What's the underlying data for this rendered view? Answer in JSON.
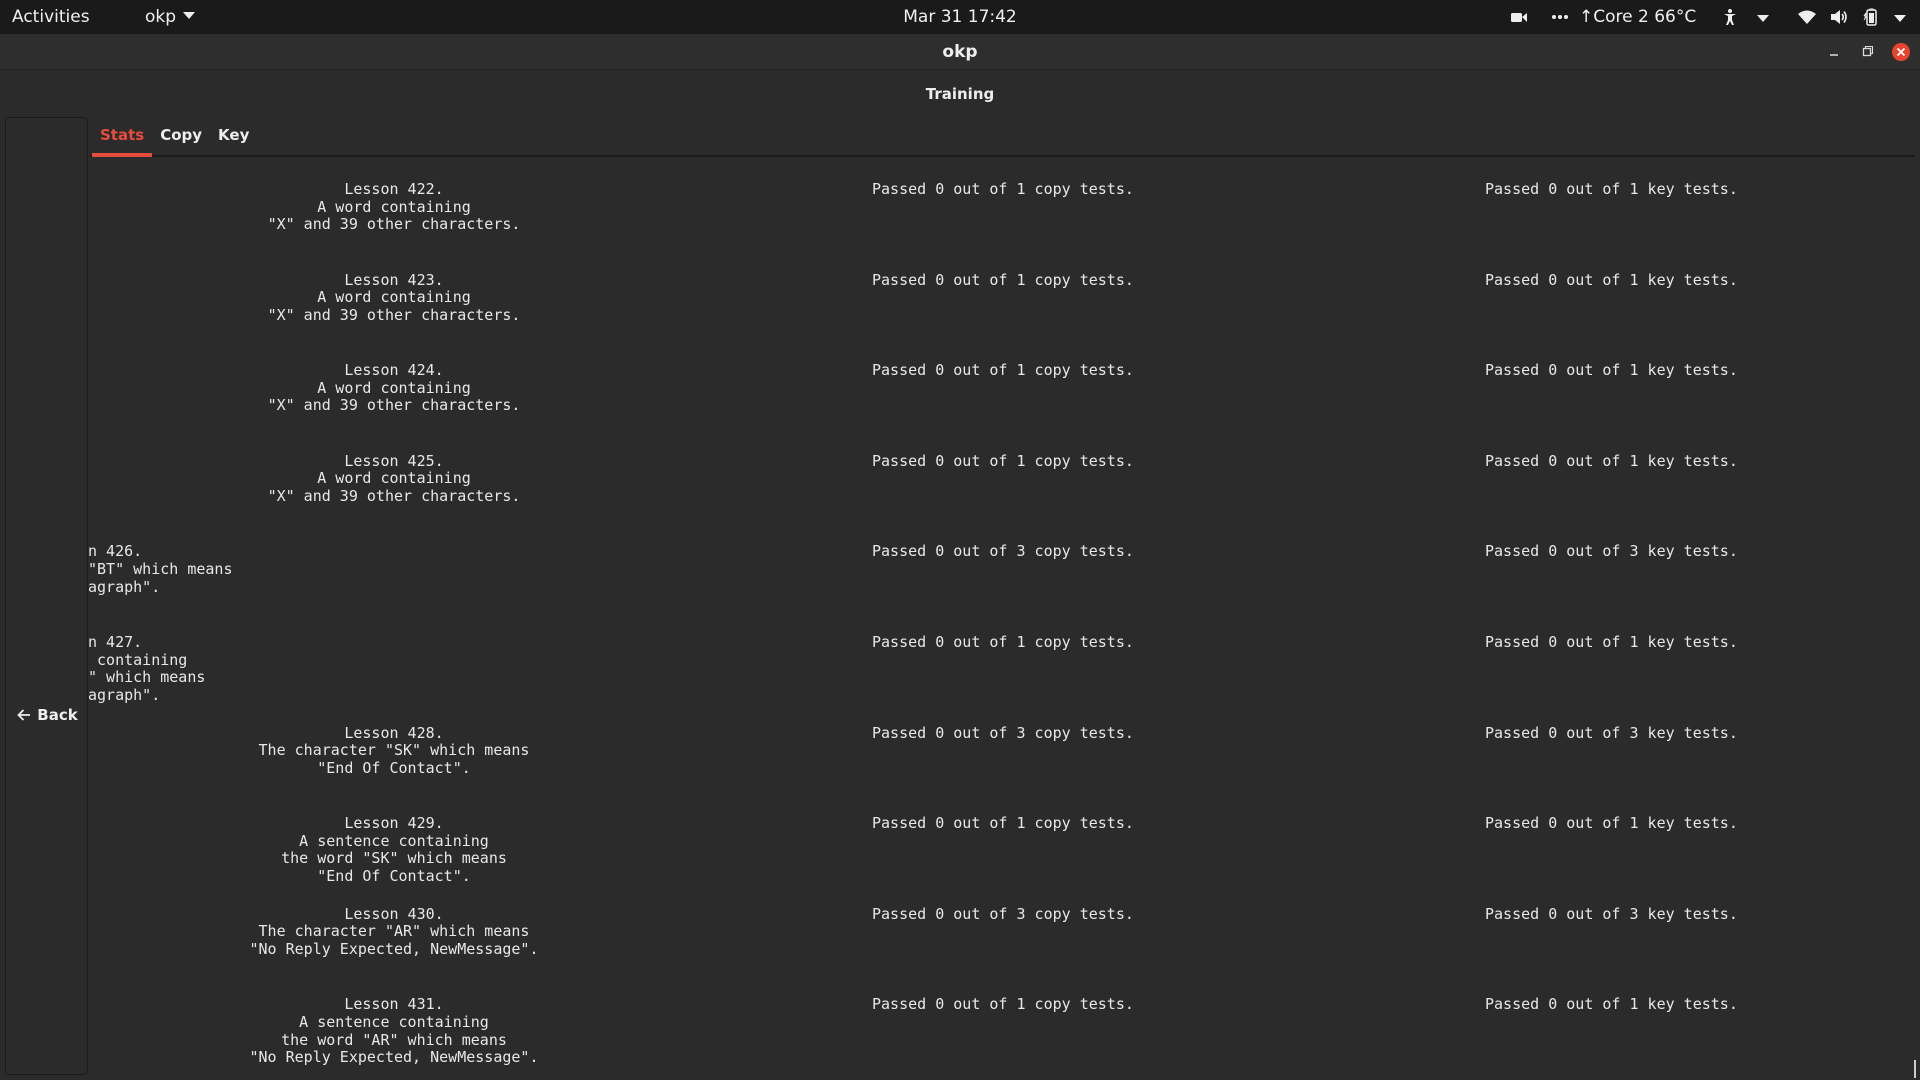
{
  "topbar": {
    "activities": "Activities",
    "app_menu": "okp",
    "clock": "Mar 31  17:42",
    "system_monitor": "↑Core 2 66°C"
  },
  "window": {
    "title": "okp",
    "header": "Training"
  },
  "nav": {
    "back_label": "Back"
  },
  "tabs": [
    {
      "label": "Stats",
      "active": true
    },
    {
      "label": "Copy",
      "active": false
    },
    {
      "label": "Key",
      "active": false
    }
  ],
  "rows": [
    {
      "lesson": "Lesson 422.\nA word containing\n\"X\" and 39 other characters.",
      "copy": "Passed 0 out of 1 copy tests.",
      "key": "Passed 0 out of 1 key tests."
    },
    {
      "lesson": "Lesson 423.\nA word containing\n\"X\" and 39 other characters.",
      "copy": "Passed 0 out of 1 copy tests.",
      "key": "Passed 0 out of 1 key tests."
    },
    {
      "lesson": "Lesson 424.\nA word containing\n\"X\" and 39 other characters.",
      "copy": "Passed 0 out of 1 copy tests.",
      "key": "Passed 0 out of 1 key tests."
    },
    {
      "lesson": "Lesson 425.\nA word containing\n\"X\" and 39 other characters.",
      "copy": "Passed 0 out of 1 copy tests.",
      "key": "Passed 0 out of 1 key tests."
    },
    {
      "lesson": "n 426.\n\"BT\" which means\nagraph\".",
      "copy": "Passed 0 out of 3 copy tests.",
      "key": "Passed 0 out of 3 key tests.",
      "partially_hidden": true
    },
    {
      "lesson": "n 427.\n containing\n\" which means\nagraph\".",
      "copy": "Passed 0 out of 1 copy tests.",
      "key": "Passed 0 out of 1 key tests.",
      "partially_hidden": true
    },
    {
      "lesson": "Lesson 428.\nThe character \"SK\" which means\n\"End Of Contact\".",
      "copy": "Passed 0 out of 3 copy tests.",
      "key": "Passed 0 out of 3 key tests."
    },
    {
      "lesson": "Lesson 429.\nA sentence containing\nthe word \"SK\" which means\n\"End Of Contact\".",
      "copy": "Passed 0 out of 1 copy tests.",
      "key": "Passed 0 out of 1 key tests."
    },
    {
      "lesson": "Lesson 430.\nThe character \"AR\" which means\n\"No Reply Expected, NewMessage\".",
      "copy": "Passed 0 out of 3 copy tests.",
      "key": "Passed 0 out of 3 key tests."
    },
    {
      "lesson": "Lesson 431.\nA sentence containing\nthe word \"AR\" which means\n\"No Reply Expected, NewMessage\".",
      "copy": "Passed 0 out of 1 copy tests.",
      "key": "Passed 0 out of 1 key tests."
    }
  ],
  "colors": {
    "accent": "#e64c3c",
    "topbar_bg": "#1a1a1a",
    "window_bg": "#2b2b2b",
    "close_button": "#e5452f"
  }
}
